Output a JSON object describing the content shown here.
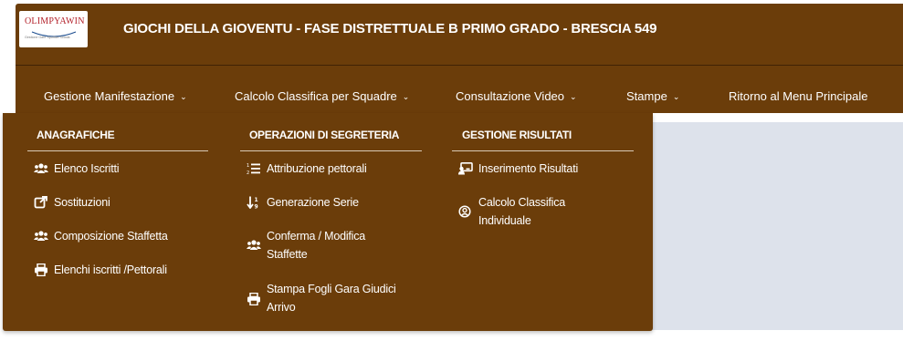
{
  "app": {
    "logo_text": "OLIMPYAWIN",
    "logo_subtext": "Gestione Gare Sportive Scuola",
    "title": "GIOCHI DELLA GIOVENTU - FASE DISTRETTUALE B PRIMO GRADO - BRESCIA 549"
  },
  "nav": {
    "items": [
      {
        "label": "Gestione Manifestazione",
        "has_dropdown": true
      },
      {
        "label": "Calcolo Classifica per Squadre",
        "has_dropdown": true
      },
      {
        "label": "Consultazione Video",
        "has_dropdown": true
      },
      {
        "label": "Stampe",
        "has_dropdown": true
      },
      {
        "label": "Ritorno al Menu Principale",
        "has_dropdown": false
      }
    ]
  },
  "dropdown": {
    "columns": [
      {
        "heading": "ANAGRAFICHE",
        "items": [
          {
            "label": "Elenco Iscritti",
            "icon": "users-icon"
          },
          {
            "label": "Sostituzioni",
            "icon": "external-link-icon"
          },
          {
            "label": "Composizione Staffetta",
            "icon": "users-icon"
          },
          {
            "label": "Elenchi iscritti /Pettorali",
            "icon": "printer-icon"
          }
        ]
      },
      {
        "heading": "OPERAZIONI DI SEGRETERIA",
        "items": [
          {
            "label": "Attribuzione pettorali",
            "icon": "numbered-list-icon"
          },
          {
            "label": "Generazione Serie",
            "icon": "sort-numeric-icon"
          },
          {
            "label": "Conferma / Modifica Staffette",
            "icon": "users-icon"
          },
          {
            "label": "Stampa Fogli Gara Giudici Arrivo",
            "icon": "printer-icon"
          }
        ]
      },
      {
        "heading": "GESTIONE RISULTATI",
        "items": [
          {
            "label": "Inserimento Risultati",
            "icon": "chalkboard-user-icon"
          },
          {
            "label": "Calcolo Classifica Individuale",
            "icon": "user-circle-icon"
          }
        ]
      }
    ]
  },
  "colors": {
    "brand_brown": "#6b3d0a",
    "background_gray": "#dde2eb",
    "text_white": "#ffffff"
  }
}
